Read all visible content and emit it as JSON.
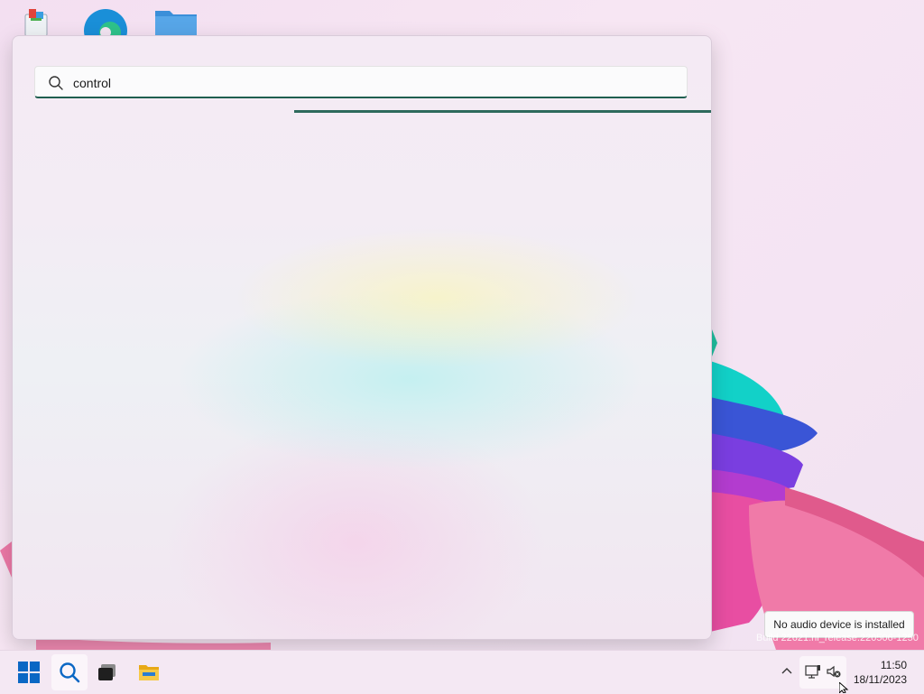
{
  "search": {
    "query": "control",
    "placeholder": ""
  },
  "tooltip": {
    "text": "No audio device is installed"
  },
  "watermark": {
    "text": "Build 22621.ni_release.220506-1250"
  },
  "clock": {
    "time": "11:50",
    "date": "18/11/2023"
  },
  "taskbar": {
    "items": [
      "start",
      "search",
      "task-view",
      "file-explorer"
    ]
  },
  "colors": {
    "accent": "#2e6a5c",
    "windows_blue": "#0a67c4"
  }
}
